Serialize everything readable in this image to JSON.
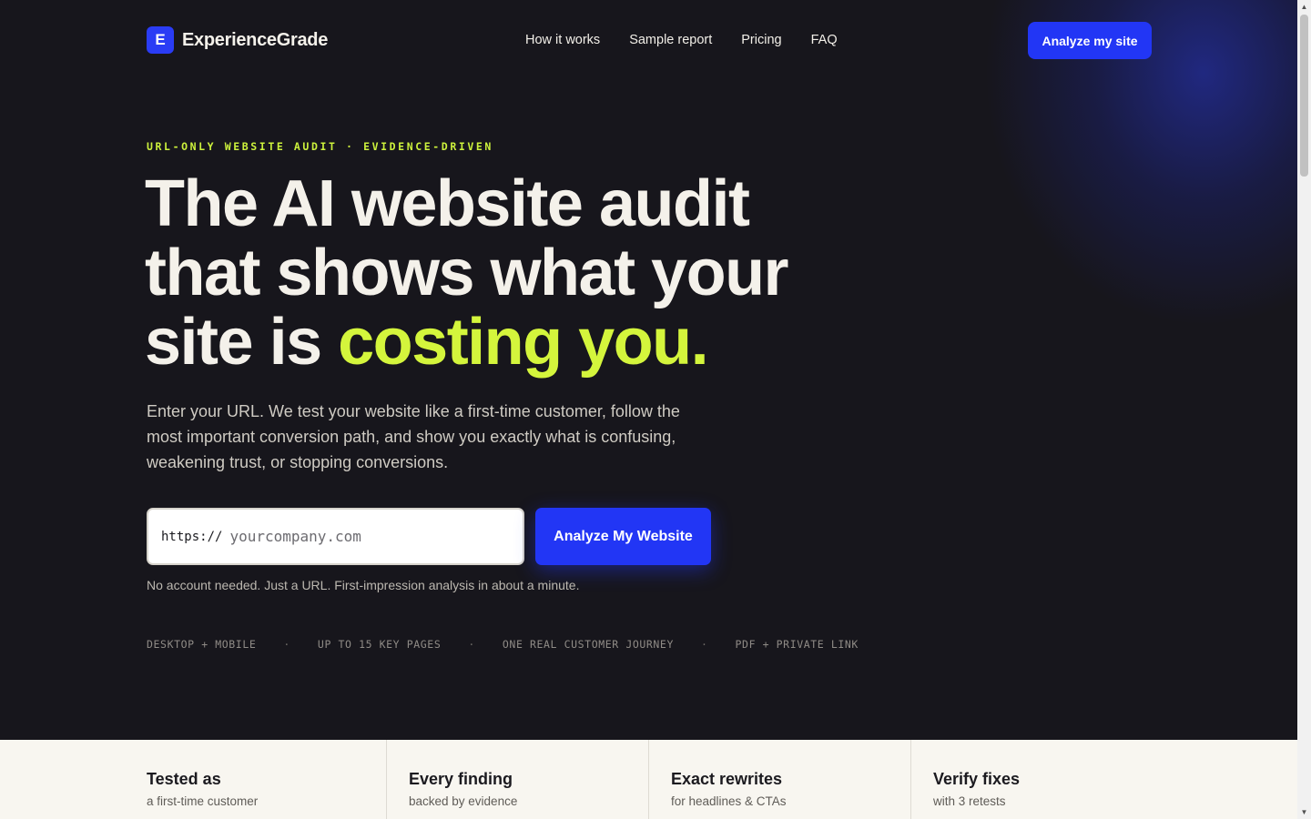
{
  "brand": {
    "mark": "E",
    "name": "ExperienceGrade"
  },
  "nav": {
    "links": [
      "How it works",
      "Sample report",
      "Pricing",
      "FAQ"
    ],
    "cta": "Analyze my site"
  },
  "hero": {
    "eyebrow": "URL-ONLY WEBSITE AUDIT · EVIDENCE-DRIVEN",
    "headline_line1": "The AI website audit",
    "headline_line2": "that shows what your",
    "headline_line3_start": "site is ",
    "headline_accent": "costing you.",
    "lede": "Enter your URL. We test your website like a first-time customer, follow the most important conversion path, and show you exactly what is confusing, weakening trust, or stopping conversions.",
    "url_prefix": "https://",
    "url_placeholder": "yourcompany.com",
    "analyze_button": "Analyze My Website",
    "form_note": "No account needed. Just a URL. First-impression analysis in about a minute.",
    "features": [
      "DESKTOP + MOBILE",
      "UP TO 15 KEY PAGES",
      "ONE REAL CUSTOMER JOURNEY",
      "PDF + PRIVATE LINK"
    ],
    "feature_separator": "·"
  },
  "strip": [
    {
      "title": "Tested as",
      "sub": "a first-time customer"
    },
    {
      "title": "Every finding",
      "sub": "backed by evidence"
    },
    {
      "title": "Exact rewrites",
      "sub": "for headlines & CTAs"
    },
    {
      "title": "Verify fixes",
      "sub": "with 3 retests"
    }
  ],
  "colors": {
    "background": "#17161c",
    "accent_blue": "#2236f5",
    "accent_lime": "#d4f53c",
    "strip_background": "#f8f6f0"
  },
  "icons": {
    "scroll_up": "scroll-up-arrow-icon",
    "scroll_down": "scroll-down-arrow-icon"
  }
}
